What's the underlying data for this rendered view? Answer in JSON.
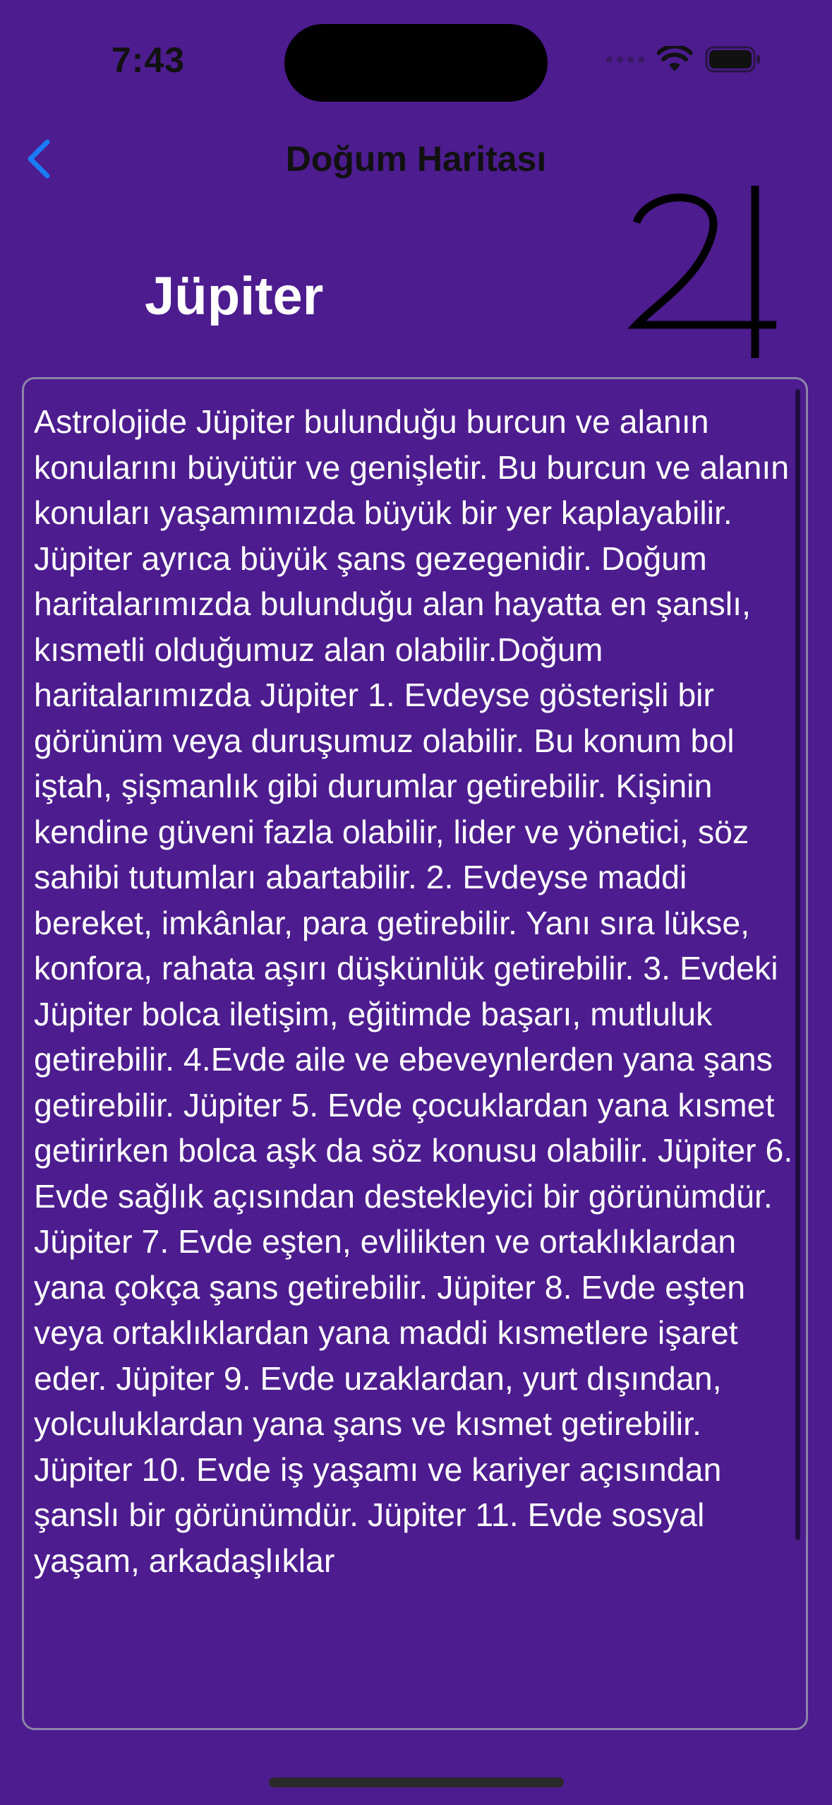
{
  "status_bar": {
    "time": "7:43"
  },
  "nav": {
    "back_icon": "chevron-left-icon",
    "title": "Doğum Haritası"
  },
  "header": {
    "planet_name": "Jüpiter",
    "planet_symbol": "♃",
    "planet_symbol_icon": "jupiter-symbol-icon"
  },
  "body_text": "Astrolojide Jüpiter bulunduğu burcun ve alanın konularını büyütür ve genişletir. Bu burcun ve alanın konuları yaşamımızda büyük bir yer kaplayabilir. Jüpiter ayrıca büyük şans gezegenidir. Doğum haritalarımızda bulunduğu alan hayatta en şanslı, kısmetli olduğumuz alan olabilir.Doğum haritalarımızda Jüpiter 1. Evdeyse gösterişli bir görünüm veya duruşumuz olabilir. Bu konum bol iştah, şişmanlık gibi durumlar getirebilir. Kişinin kendine güveni fazla olabilir, lider ve yönetici, söz sahibi tutumları abartabilir. 2. Evdeyse maddi bereket, imkânlar, para getirebilir. Yanı sıra lükse, konfora, rahata aşırı düşkünlük getirebilir. 3. Evdeki Jüpiter bolca iletişim, eğitimde başarı, mutluluk getirebilir. 4.Evde aile ve ebeveynlerden yana şans getirebilir. Jüpiter 5. Evde çocuklardan yana kısmet getirirken bolca aşk da söz konusu olabilir. Jüpiter 6. Evde sağlık açısından destekleyici bir görünümdür. Jüpiter 7. Evde eşten, evlilikten ve ortaklıklardan yana çokça şans getirebilir. Jüpiter 8. Evde eşten veya ortaklıklardan yana maddi kısmetlere işaret eder. Jüpiter 9. Evde uzaklardan, yurt dışından, yolculuklardan yana şans ve kısmet getirebilir. Jüpiter 10. Evde iş yaşamı ve kariyer açısından şanslı bir görünümdür. Jüpiter 11. Evde sosyal yaşam, arkadaşlıklar",
  "colors": {
    "background": "#4d1c8f",
    "accent": "#1a7cf5",
    "text": "#ffffff",
    "nav_text": "#111111"
  }
}
